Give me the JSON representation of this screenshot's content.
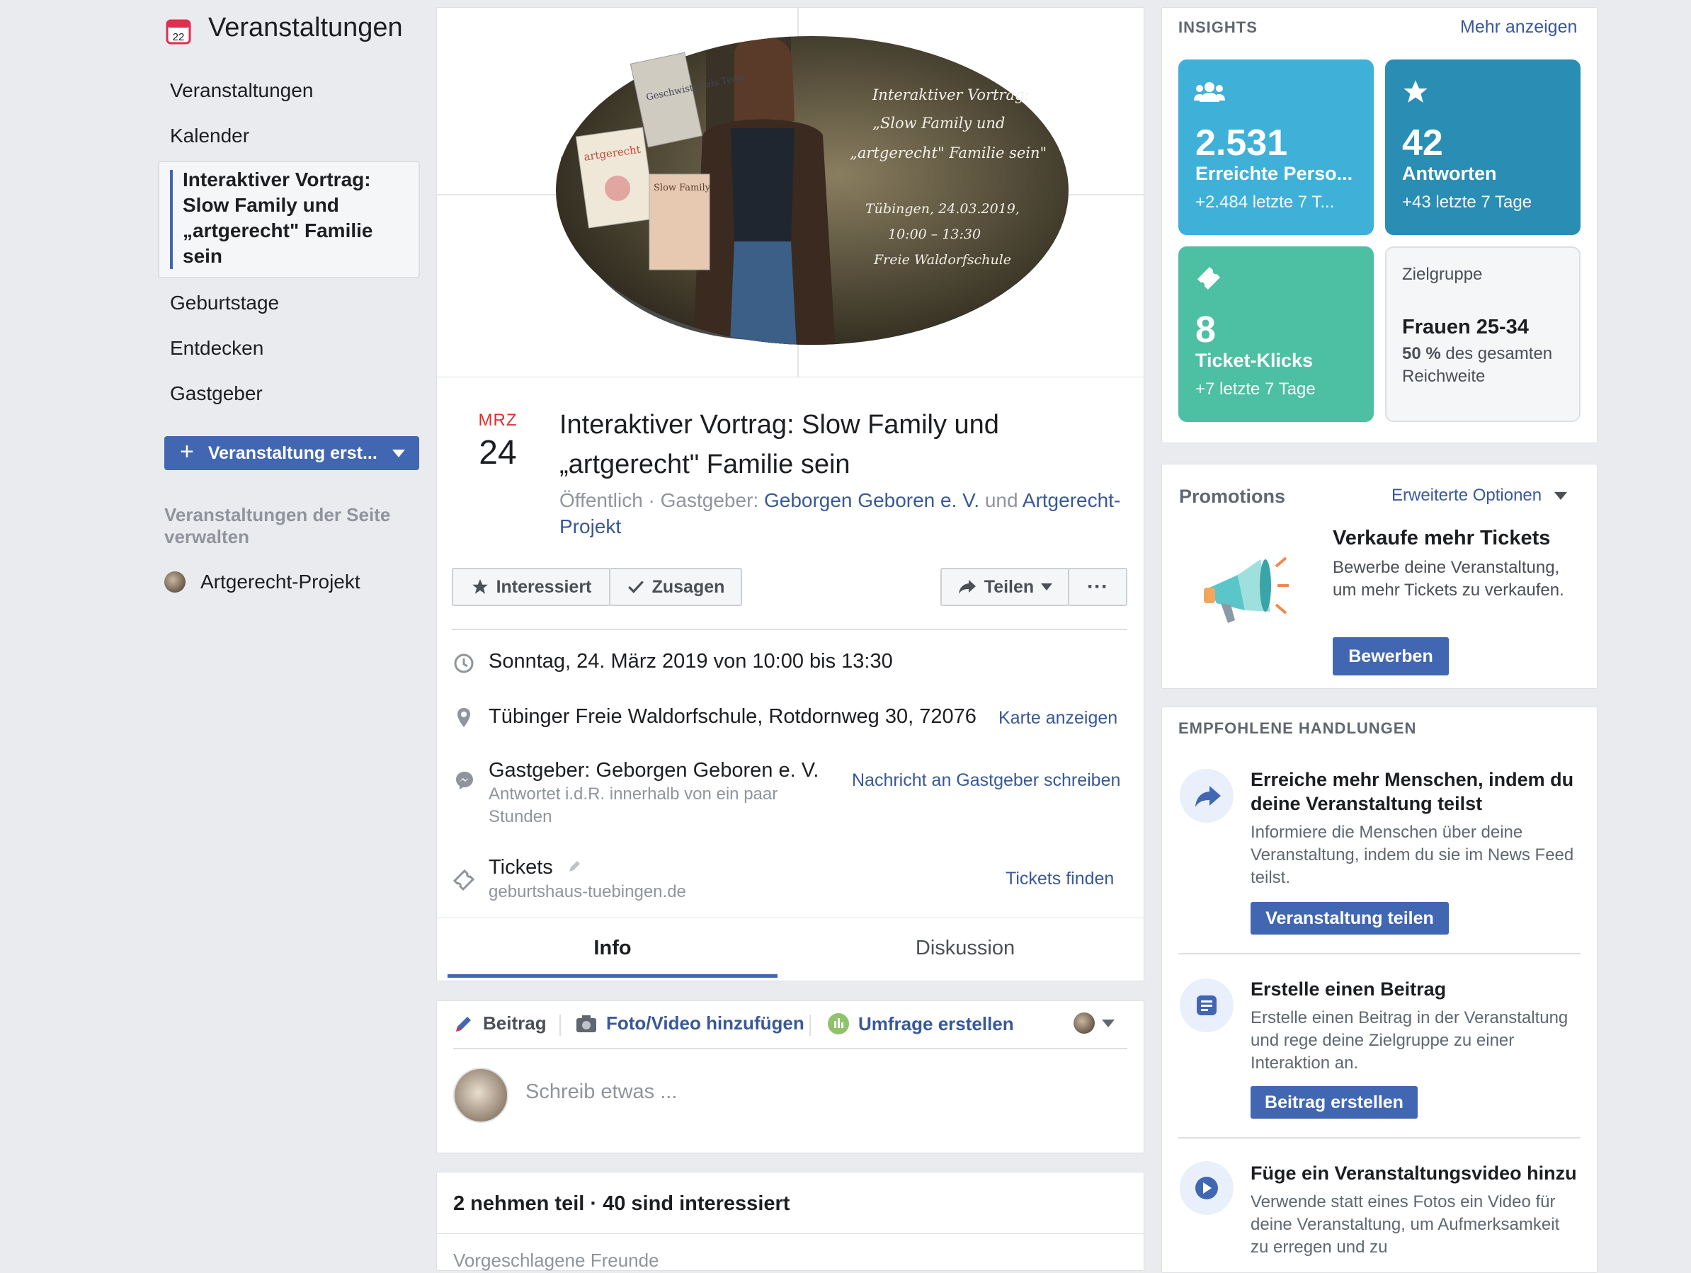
{
  "sidebar": {
    "title": "Veranstaltungen",
    "items": [
      "Veranstaltungen",
      "Kalender",
      "Geburtstage",
      "Entdecken",
      "Gastgeber"
    ],
    "active_event": "Interaktiver Vortrag: Slow Family und „artgerecht\" Familie sein",
    "calendar_day": "22",
    "create_button": "Veranstaltung erst...",
    "manage_section": "Veranstaltungen der Seite verwalten",
    "page_name": "Artgerecht-Projekt"
  },
  "cover": {
    "line1": "Interaktiver Vortrag:",
    "line2": "„Slow Family und",
    "line3": "„artgerecht\" Familie sein\"",
    "date": "Tübingen, 24.03.2019,",
    "time": "10:00 – 13:30",
    "place": "Freie Waldorfschule",
    "book1": "Geschwister als Team",
    "book2": "artgerecht",
    "book3": "Slow Family"
  },
  "event": {
    "month": "MRZ",
    "day": "24",
    "title": "Interaktiver Vortrag: Slow Family und „artgerecht\" Familie sein",
    "visibility": "Öffentlich · Gastgeber:",
    "host1": "Geborgen Geboren e. V.",
    "and": "und",
    "host2": "Artgerecht-Projekt"
  },
  "actions": {
    "interested": "Interessiert",
    "going": "Zusagen",
    "share": "Teilen",
    "more": "···"
  },
  "details": {
    "datetime": "Sonntag, 24. März 2019 von 10:00 bis 13:30",
    "location": "Tübinger Freie Waldorfschule, Rotdornweg 30, 72076",
    "map_link": "Karte anzeigen",
    "host": "Gastgeber: Geborgen Geboren e. V.",
    "host_reply": "Antwortet i.d.R. innerhalb von ein paar Stunden",
    "message_link": "Nachricht an Gastgeber schreiben",
    "tickets": "Tickets",
    "tickets_url": "geburtshaus-tuebingen.de",
    "tickets_link": "Tickets finden"
  },
  "tabs": [
    "Info",
    "Diskussion"
  ],
  "composer": {
    "post": "Beitrag",
    "photo": "Foto/Video hinzufügen",
    "poll": "Umfrage erstellen",
    "placeholder": "Schreib etwas ..."
  },
  "attendance": {
    "summary": "2 nehmen teil · 40 sind interessiert",
    "suggested": "Vorgeschlagene Freunde"
  },
  "insights": {
    "heading": "INSIGHTS",
    "more": "Mehr anzeigen",
    "reach": {
      "value": "2.531",
      "label": "Erreichte Perso...",
      "delta": "+2.484 letzte 7 T..."
    },
    "responses": {
      "value": "42",
      "label": "Antworten",
      "delta": "+43 letzte 7 Tage"
    },
    "tickets": {
      "value": "8",
      "label": "Ticket-Klicks",
      "delta": "+7 letzte 7 Tage"
    },
    "audience": {
      "heading": "Zielgruppe",
      "group": "Frauen 25-34",
      "pct": "50 %",
      "rest": "des gesamten Reichweite"
    },
    "colors": {
      "reach": "#3fb0d8",
      "responses": "#2a8db3",
      "tickets": "#4dbfa3"
    }
  },
  "promotions": {
    "heading": "Promotions",
    "options": "Erweiterte Optionen",
    "title": "Verkaufe mehr Tickets",
    "text": "Bewerbe deine Veranstaltung, um mehr Tickets zu verkaufen.",
    "button": "Bewerben"
  },
  "recommended": {
    "heading": "EMPFOHLENE HANDLUNGEN",
    "items": [
      {
        "title": "Erreiche mehr Menschen, indem du deine Veranstaltung teilst",
        "text": "Informiere die Menschen über deine Veranstaltung, indem du sie im News Feed teilst.",
        "button": "Veranstaltung teilen"
      },
      {
        "title": "Erstelle einen Beitrag",
        "text": "Erstelle einen Beitrag in der Veranstaltung und rege deine Zielgruppe zu einer Interaktion an.",
        "button": "Beitrag erstellen"
      },
      {
        "title": "Füge ein Veranstaltungsvideo hinzu",
        "text": "Verwende statt eines Fotos ein Video für deine Veranstaltung, um Aufmerksamkeit zu erregen und zu"
      }
    ]
  }
}
